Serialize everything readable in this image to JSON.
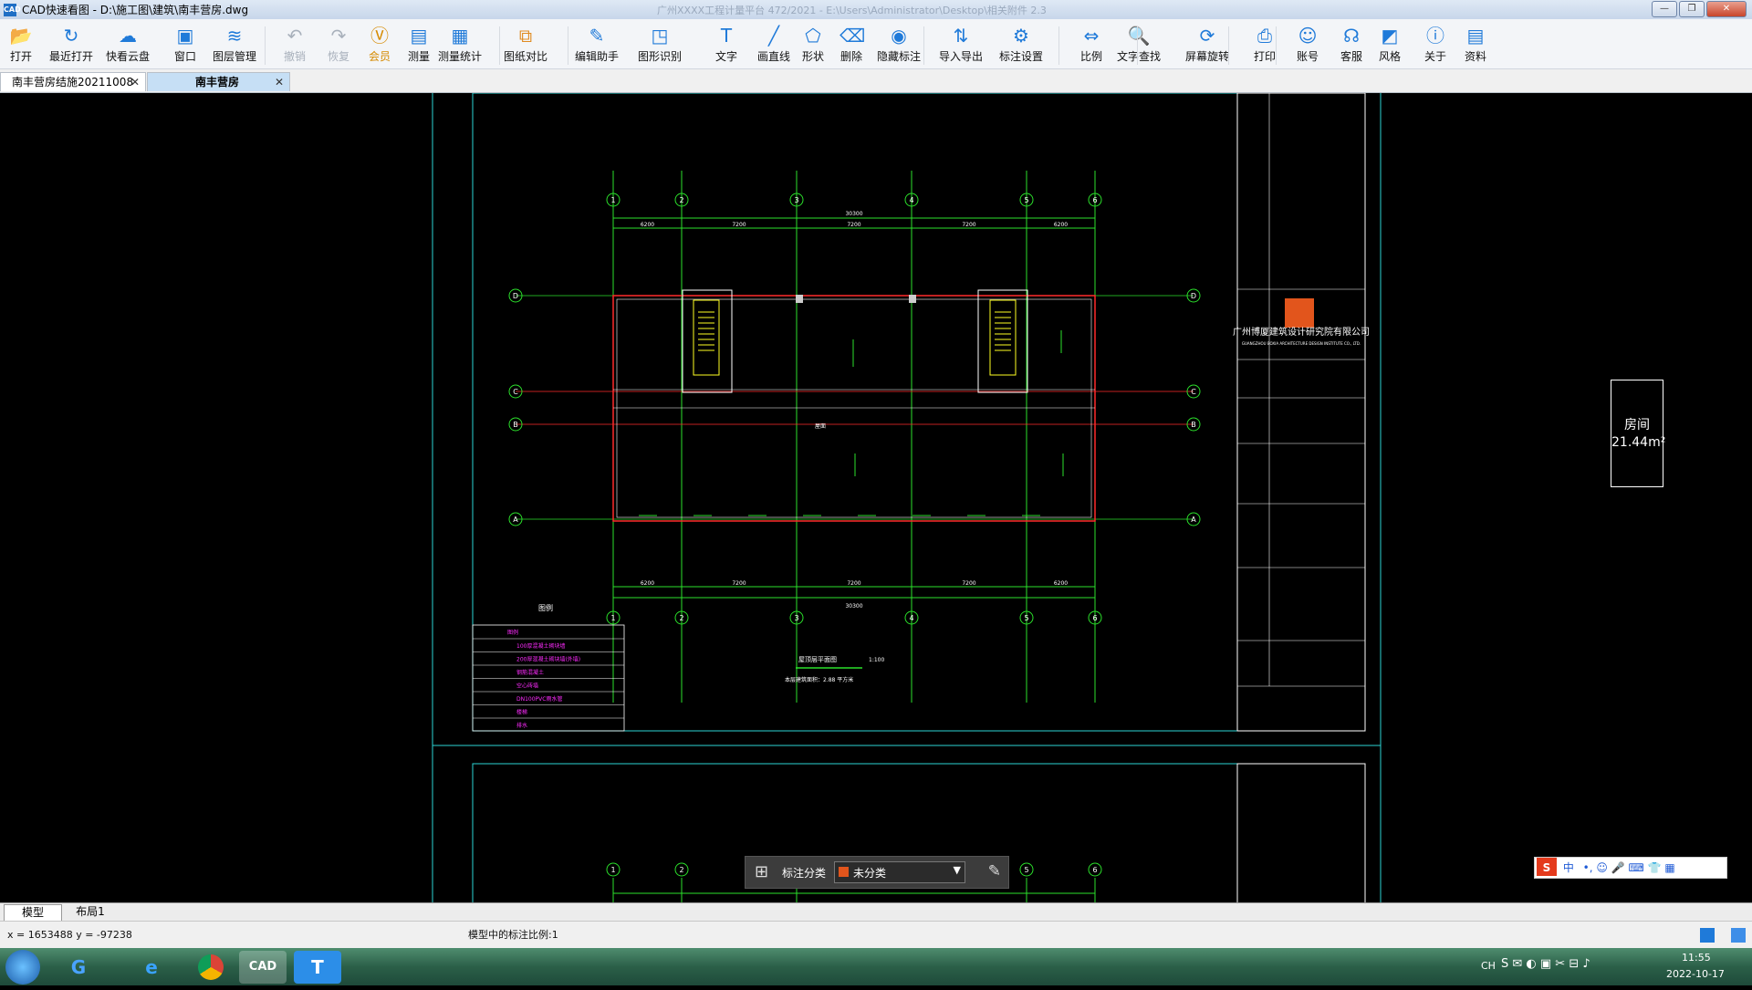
{
  "window": {
    "title": "CAD快速看图 - D:\\施工图\\建筑\\南丰营房.dwg",
    "app_icon": "CAD",
    "faded_title": "广州XXXX工程计量平台 472/2021  -  E:\\Users\\Administrator\\Desktop\\相关附件 2.3"
  },
  "toolbar": {
    "items": [
      {
        "label": "打开",
        "icon": "folder-open-icon"
      },
      {
        "label": "最近打开",
        "icon": "recent-icon"
      },
      {
        "label": "快看云盘",
        "icon": "cloud-icon"
      },
      {
        "label": "窗口",
        "icon": "window-icon"
      },
      {
        "label": "图层管理",
        "icon": "layers-icon"
      },
      {
        "label": "撤销",
        "icon": "undo-icon"
      },
      {
        "label": "恢复",
        "icon": "redo-icon"
      },
      {
        "label": "会员",
        "icon": "vip-icon"
      },
      {
        "label": "测量",
        "icon": "ruler-icon"
      },
      {
        "label": "测量统计",
        "icon": "measure-stats-icon"
      },
      {
        "label": "图纸对比",
        "icon": "compare-icon"
      },
      {
        "label": "编辑助手",
        "icon": "edit-assistant-icon"
      },
      {
        "label": "图形识别",
        "icon": "shape-recognize-icon"
      },
      {
        "label": "文字",
        "icon": "text-icon"
      },
      {
        "label": "画直线",
        "icon": "line-icon"
      },
      {
        "label": "形状",
        "icon": "shape-icon"
      },
      {
        "label": "删除",
        "icon": "eraser-icon"
      },
      {
        "label": "隐藏标注",
        "icon": "hide-annotation-icon"
      },
      {
        "label": "导入导出",
        "icon": "import-export-icon"
      },
      {
        "label": "标注设置",
        "icon": "annotation-settings-icon"
      },
      {
        "label": "比例",
        "icon": "scale-icon"
      },
      {
        "label": "文字查找",
        "icon": "text-search-icon"
      },
      {
        "label": "屏幕旋转",
        "icon": "rotate-screen-icon"
      },
      {
        "label": "打印",
        "icon": "printer-icon"
      },
      {
        "label": "账号",
        "icon": "account-icon"
      },
      {
        "label": "客服",
        "icon": "headset-icon"
      },
      {
        "label": "风格",
        "icon": "style-icon"
      },
      {
        "label": "关于",
        "icon": "info-icon"
      },
      {
        "label": "资料",
        "icon": "docs-icon"
      }
    ]
  },
  "tabs": [
    {
      "label": "南丰营房结施20211008"
    },
    {
      "label": "南丰营房"
    }
  ],
  "drawing": {
    "axes_top": [
      "1",
      "2",
      "3",
      "4",
      "5",
      "6"
    ],
    "axes_side": [
      "D",
      "C",
      "B",
      "A"
    ],
    "dim_total": "30300",
    "dim_spans": [
      "6200",
      "7200",
      "7200",
      "7200",
      "6200"
    ],
    "plan_title": "屋顶层平面图",
    "plan_scale": "1:100",
    "area_note": "本层建筑面积：2.88 平方米",
    "legend_title": "图例",
    "legend_header": "图例",
    "legend_items": [
      "100厚混凝土砌块墙",
      "200厚混凝土砌块墙(外墙)",
      "钢筋混凝土",
      "空心砖墙",
      "DN100PVC雨水管",
      "楼梯",
      "排水"
    ],
    "company_name": "广州博厦建筑设计研究院有限公司",
    "company_en": "GUANGZHOU BOXIA ARCHITECTURE DESIGN INSTITUTE CO., LTD.",
    "room_label": "房间",
    "room_area": "21.44m²",
    "center_label": "屋面"
  },
  "annotation_bar": {
    "label": "标注分类",
    "selected": "未分类"
  },
  "bottom_tabs": [
    {
      "label": "模型"
    },
    {
      "label": "布局1"
    }
  ],
  "status": {
    "coords": "x = 1653488  y = -97238",
    "scale_text": "模型中的标注比例:1"
  },
  "ime": {
    "label": "中"
  },
  "clock": {
    "time": "11:55",
    "date": "2022-10-17"
  },
  "tray": {
    "lang": "CH"
  }
}
